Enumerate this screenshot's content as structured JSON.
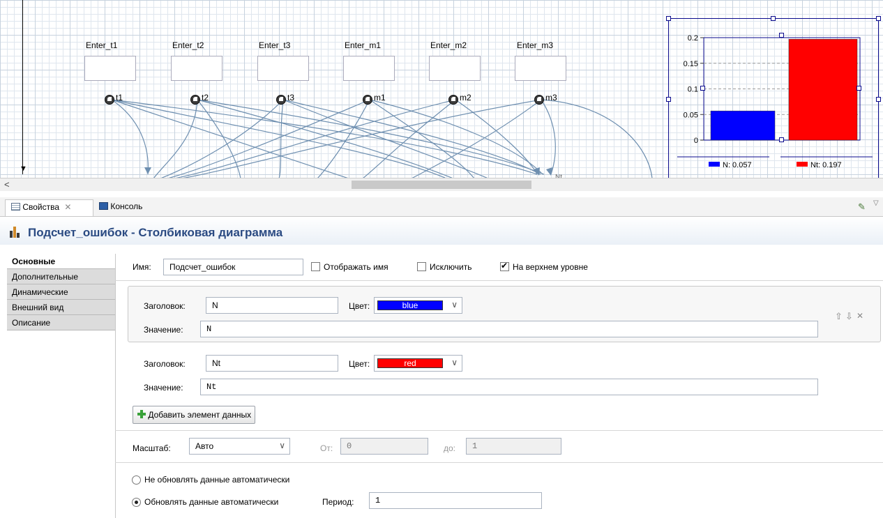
{
  "canvas": {
    "enter_labels": [
      "Enter_t1",
      "Enter_t2",
      "Enter_t3",
      "Enter_m1",
      "Enter_m2",
      "Enter_m3"
    ],
    "params": [
      "t1",
      "t2",
      "t3",
      "m1",
      "m2",
      "m3"
    ],
    "partial_label": "Nt"
  },
  "chart_data": {
    "type": "bar",
    "categories": [
      "N",
      "Nt"
    ],
    "values": [
      0.057,
      0.197
    ],
    "colors": [
      "#0000ff",
      "#ff0000"
    ],
    "ylim": [
      0,
      0.2
    ],
    "yticks": [
      "0.2",
      "0.15",
      "0.1",
      "0.05",
      "0"
    ],
    "legend": [
      "N: 0.057",
      "Nt: 0.197"
    ],
    "legend_position": "bottom"
  },
  "tabs": [
    {
      "label": "Свойства",
      "icon": "properties-icon"
    },
    {
      "label": "Консоль",
      "icon": "console-icon"
    }
  ],
  "header": {
    "title": "Подсчет_ошибок - Столбиковая диаграмма"
  },
  "sidebar": {
    "items": [
      {
        "label": "Основные"
      },
      {
        "label": "Дополнительные"
      },
      {
        "label": "Динамические"
      },
      {
        "label": "Внешний вид"
      },
      {
        "label": "Описание"
      }
    ]
  },
  "form": {
    "name_label": "Имя:",
    "name_value": "Подсчет_ошибок",
    "show_name": "Отображать имя",
    "exclude": "Исключить",
    "top_level": "На верхнем уровне",
    "items": [
      {
        "title_label": "Заголовок:",
        "title_value": "N",
        "color_label": "Цвет:",
        "color_name": "blue",
        "color": "#0000ff",
        "value_label": "Значение:",
        "value": "N"
      },
      {
        "title_label": "Заголовок:",
        "title_value": "Nt",
        "color_label": "Цвет:",
        "color_name": "red",
        "color": "#ff0000",
        "value_label": "Значение:",
        "value": "Nt"
      }
    ],
    "add_button": "Добавить элемент данных",
    "scale_label": "Масштаб:",
    "scale_value": "Авто",
    "from_label": "От:",
    "from_value": "0",
    "to_label": "до:",
    "to_value": "1",
    "no_auto_update": "Не обновлять данные автоматически",
    "auto_update": "Обновлять данные автоматически",
    "period_label": "Период:",
    "period_value": "1"
  }
}
